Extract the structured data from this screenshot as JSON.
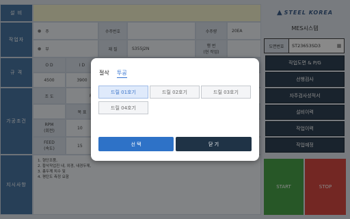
{
  "left": {
    "labels": {
      "equipment": "설 비",
      "worker": "작업자",
      "spec": "규 격",
      "process": "가공조건",
      "instructions": "지시사항"
    },
    "worker": {
      "main": "주",
      "sub": "부"
    },
    "order": {
      "order_no_label": "수주번호",
      "qty_label": "수주량",
      "qty_value": "20EA",
      "material_label": "재 질",
      "material_value": "S355J2N",
      "line_label_1": "행 번",
      "line_label_2": "(현 작업)"
    },
    "spec": {
      "od_label": "O D",
      "id_label": "I D",
      "od_value": "4500",
      "id_value": "3900"
    },
    "process": {
      "stage_label": "조 도",
      "stage_value": "R",
      "target_label": "목 표",
      "rpm_label_1": "RPM",
      "rpm_label_2": "(회전)",
      "rpm_value": "10",
      "feed_label_1": "FEED",
      "feed_label_2": "(속도)",
      "feed_value": "15"
    },
    "notes": [
      "1. 형단조품,",
      "2. 황삭작업진 내, 외경, 내경두께,",
      "3. 총두께 치수 및",
      "4. 평탄도 측정 요함"
    ]
  },
  "right": {
    "logo": "STEEL KOREA",
    "system_title": "MES시스템",
    "drawing_label": "도면번호",
    "drawing_value": "ST23653SD3",
    "menu": [
      "작업도면 & P/G",
      "선행검사",
      "자주검사성적서",
      "설비이력",
      "작업이력",
      "작업예정"
    ],
    "start_label": "START",
    "stop_label": "STOP",
    "start_color": "#3a9a3a",
    "stop_color": "#d23a33"
  },
  "modal": {
    "tabs": [
      "절삭",
      "투공"
    ],
    "active_tab": 1,
    "options": [
      "드릴 01호기",
      "드릴 02호기",
      "드릴 03호기",
      "드릴 04호기"
    ],
    "selected_option": 0,
    "select_label": "선 택",
    "close_label": "닫 기",
    "select_color": "#2e72c7",
    "close_color": "#1f3346"
  }
}
